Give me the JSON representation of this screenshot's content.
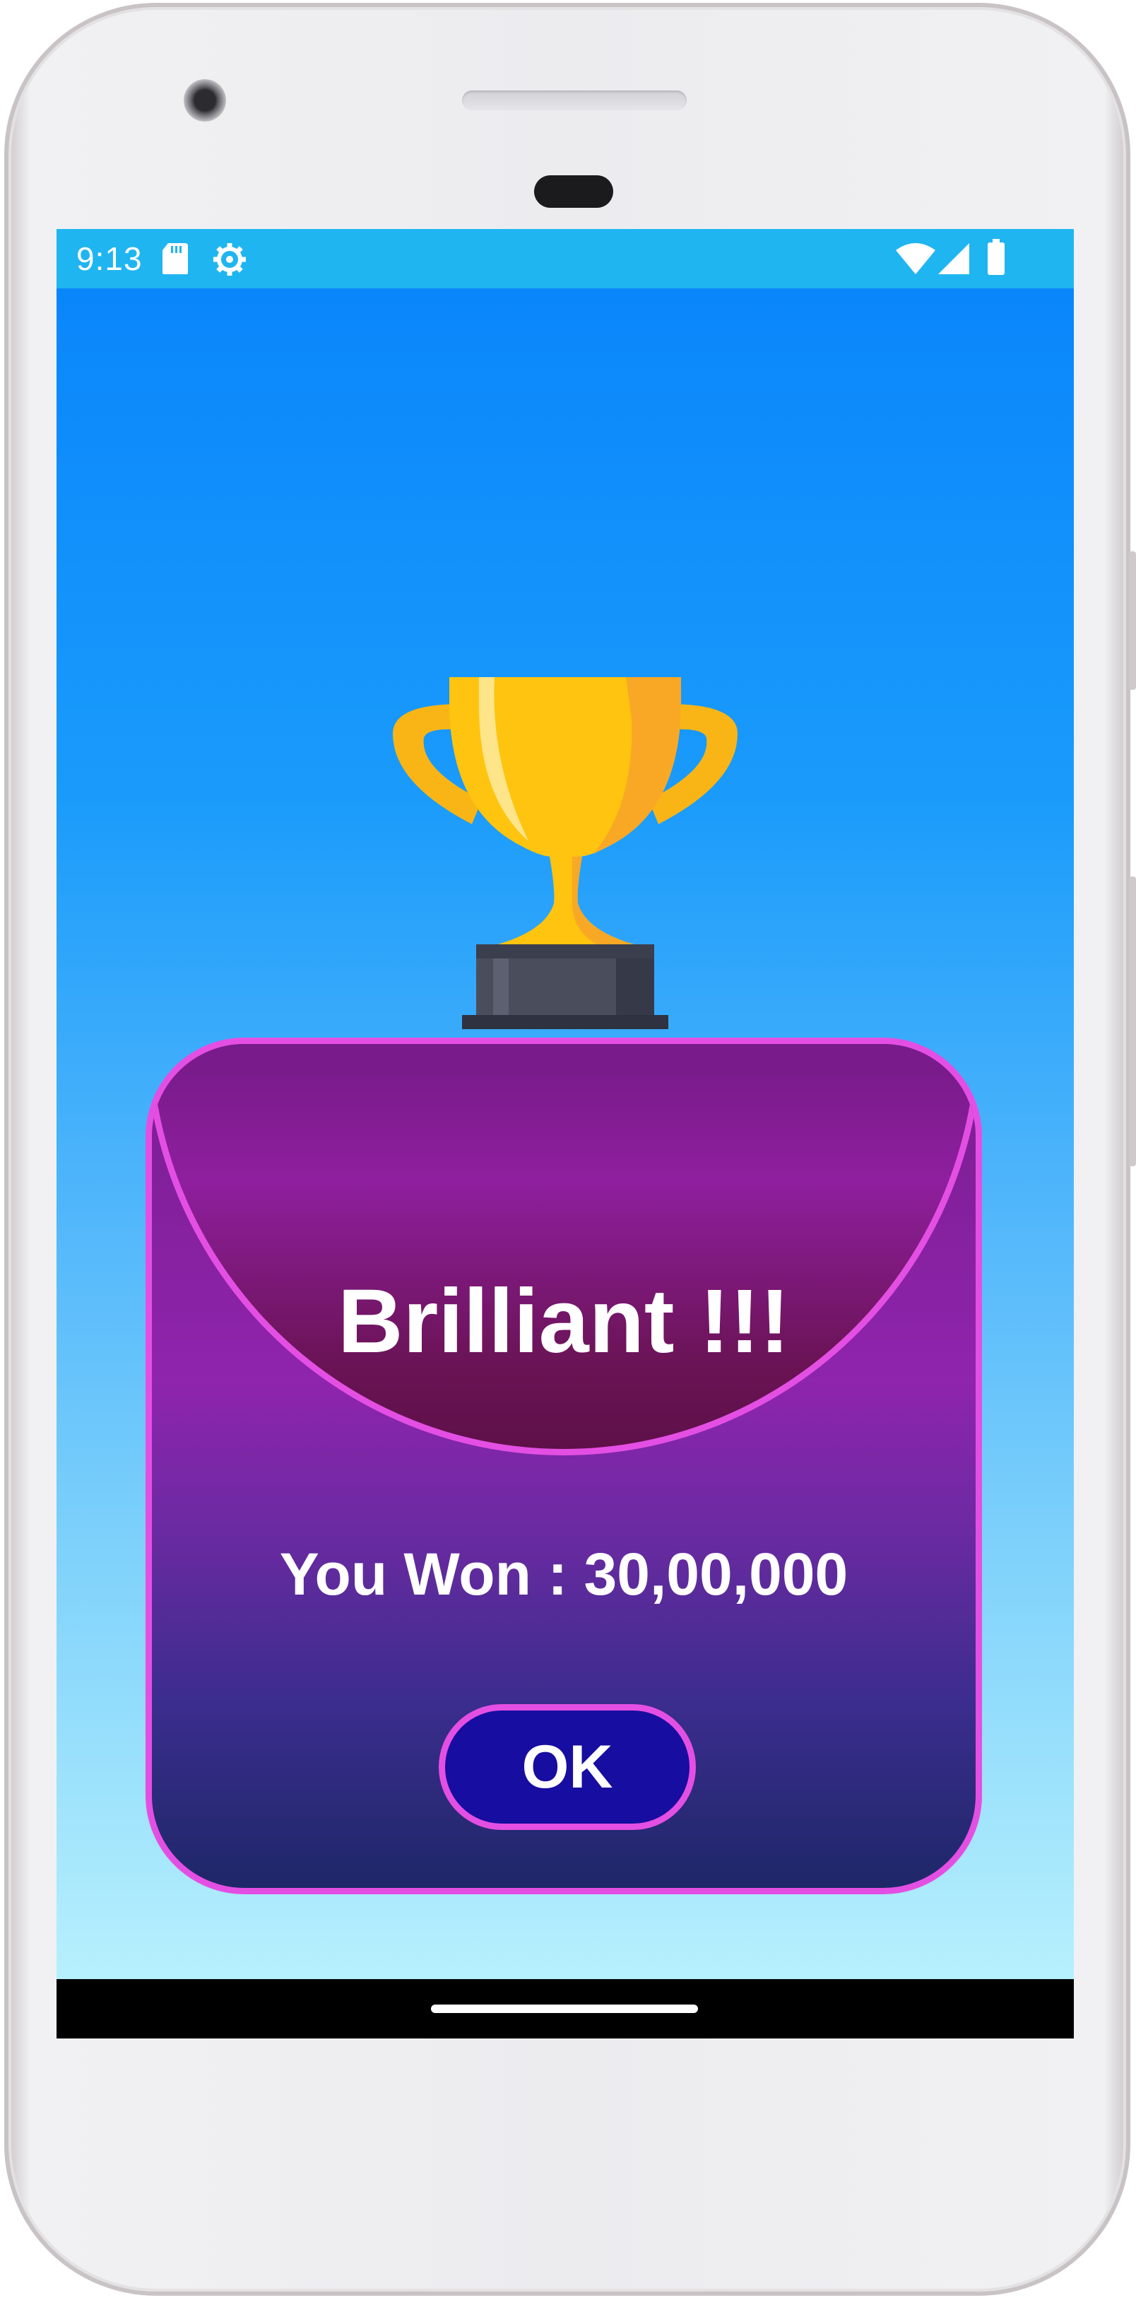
{
  "statusbar": {
    "time": "9:13",
    "left_icons": [
      "sd-card-icon",
      "settings-gear-icon"
    ],
    "right_icons": [
      "wifi-icon",
      "cell-signal-icon",
      "battery-icon"
    ],
    "color": "#1fb5f1"
  },
  "dialog": {
    "title": "Brilliant !!!",
    "message": "You Won : 30,00,000",
    "ok_label": "OK",
    "icon": "trophy-icon",
    "border_color": "#e44fe3",
    "button_color": "#170da0"
  },
  "background": {
    "gradient_top": "#0a86fb",
    "gradient_bottom": "#b7f0fd"
  }
}
